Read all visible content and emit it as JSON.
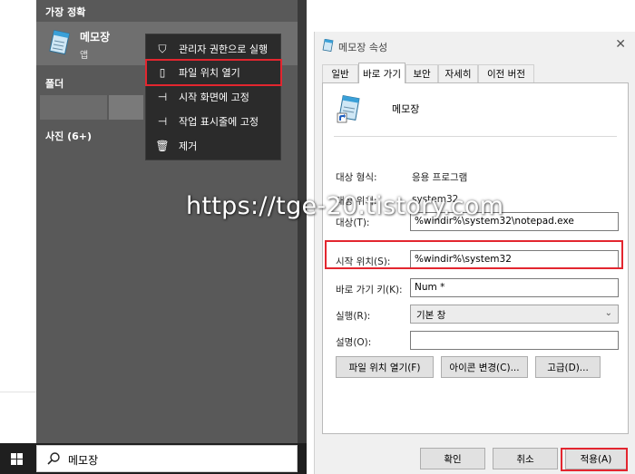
{
  "start_menu": {
    "best_match_header": "가장 정확",
    "best_match": {
      "name": "메모장",
      "type": "앱"
    },
    "folder_header": "폴더",
    "photo_header": "사진 (6+)"
  },
  "context_menu": {
    "items": [
      {
        "label": "관리자 권한으로 실행",
        "icon": "admin-shield-icon"
      },
      {
        "label": "파일 위치 열기",
        "icon": "file-location-icon"
      },
      {
        "label": "시작 화면에 고정",
        "icon": "pin-icon"
      },
      {
        "label": "작업 표시줄에 고정",
        "icon": "pin-icon"
      },
      {
        "label": "제거",
        "icon": "trash-icon"
      }
    ]
  },
  "taskbar": {
    "search_text": "메모장"
  },
  "dialog": {
    "title": "메모장 속성",
    "tabs": [
      "일반",
      "바로 가기",
      "보안",
      "자세히",
      "이전 버전"
    ],
    "active_tab": "바로 가기",
    "name": "메모장",
    "target_type_label": "대상 형식:",
    "target_type_value": "응용 프로그램",
    "target_location_label": "대상 위치:",
    "target_location_value": "system32",
    "target_label": "대상(T):",
    "target_value": "%windir%\\system32\\notepad.exe",
    "start_in_label": "시작 위치(S):",
    "start_in_value": "%windir%\\system32",
    "shortcut_key_label": "바로 가기 키(K):",
    "shortcut_key_value": "Num *",
    "run_label": "실행(R):",
    "run_value": "기본 창",
    "comment_label": "설명(O):",
    "comment_value": "",
    "buttons": {
      "open_location": "파일 위치 열기(F)",
      "change_icon": "아이콘 변경(C)...",
      "advanced": "고급(D)...",
      "ok": "확인",
      "cancel": "취소",
      "apply": "적용(A)"
    }
  },
  "watermark": "https://tge-20.tistory.com",
  "colors": {
    "highlight": "#e3262f",
    "start_bg": "#595959",
    "context_bg": "#2b2b2b",
    "taskbar": "#1f1f1f"
  }
}
